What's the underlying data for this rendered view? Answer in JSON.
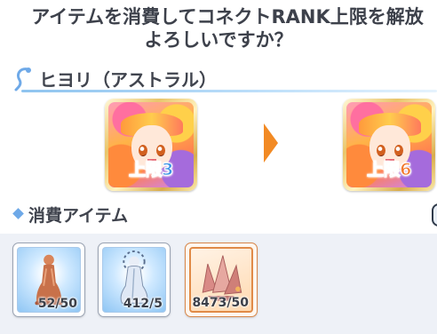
{
  "message": {
    "line1": "アイテムを消費してコネクトRANK上限を解放",
    "line2": "よろしいですか？"
  },
  "character": {
    "name": "ヒヨリ（アストラル）",
    "before_limit": "上限3",
    "after_limit": "上限6"
  },
  "items_section": {
    "title": "消費アイテム",
    "items": [
      {
        "icon": "statue-icon",
        "count": "52/50"
      },
      {
        "icon": "crystal-statue-icon",
        "count": "412/5"
      },
      {
        "icon": "crystal-shard-icon",
        "count": "8473/50"
      }
    ]
  },
  "colors": {
    "before_limit": "#3f95e6",
    "after_limit": "#f2792e",
    "arrow": "#f28a24",
    "accent_blue": "#6ea9e8"
  }
}
